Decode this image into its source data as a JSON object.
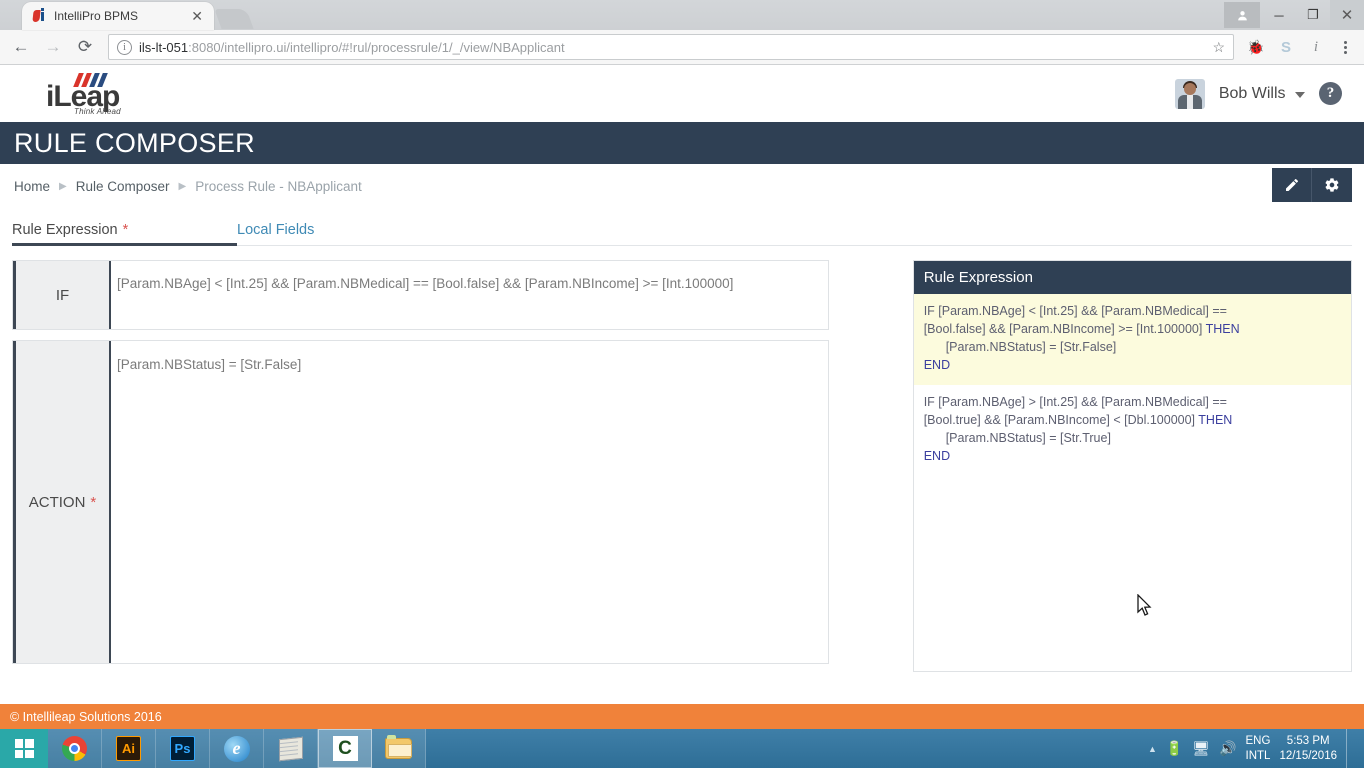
{
  "browser": {
    "tab": {
      "title": "IntelliPro BPMS",
      "favicon_icon": "ileap-favicon",
      "close_icon": "close-icon"
    },
    "new_tab_icon": "new-tab-icon",
    "window_controls": {
      "profile_icon": "person-icon",
      "minimize_label": "─",
      "maximize_label": "❐",
      "close_label": "✕"
    },
    "nav": {
      "back_label": "←",
      "forward_label": "→",
      "reload_label": "⟳"
    },
    "omnibox": {
      "info_icon": "site-info-icon",
      "info_label": "i",
      "host": "ils-lt-051",
      "path": ":8080/intellipro.ui/intellipro/#!rul/processrule/1/_/view/NBApplicant",
      "url_full": "ils-lt-051:8080/intellipro.ui/intellipro/#!rul/processrule/1/_/view/NBApplicant",
      "star_label": "☆"
    },
    "extensions": [
      {
        "name": "bug-icon",
        "label": "🐞"
      },
      {
        "name": "skype-icon",
        "label": "S"
      },
      {
        "name": "info-extension-icon",
        "label": "i"
      }
    ],
    "menu_icon": "three-dot-menu-icon"
  },
  "app": {
    "logo": {
      "word": "iLeap",
      "tagline": "Think Ahead"
    },
    "user": {
      "name": "Bob Wills",
      "avatar_icon": "avatar",
      "caret_icon": "chevron-down-icon"
    },
    "help_icon_label": "?",
    "page_title": "RULE COMPOSER",
    "breadcrumb": [
      {
        "label": "Home",
        "muted": false
      },
      {
        "label": "Rule Composer",
        "muted": false
      },
      {
        "label": "Process Rule - NBApplicant",
        "muted": true
      }
    ],
    "breadcrumb_separator": "▶",
    "actions": [
      {
        "name": "edit-button",
        "icon": "pencil-icon"
      },
      {
        "name": "settings-button",
        "icon": "gear-icon"
      }
    ],
    "tabs": [
      {
        "label": "Rule Expression",
        "required": "*",
        "active": true
      },
      {
        "label": "Local Fields",
        "required": "",
        "active": false
      }
    ],
    "rule_rows": [
      {
        "label": "IF",
        "required": "",
        "value": "[Param.NBAge] < [Int.25]  &&  [Param.NBMedical] == [Bool.false]   &&   [Param.NBIncome] >= [Int.100000]"
      },
      {
        "label": "ACTION",
        "required": "*",
        "value": "[Param.NBStatus] = [Str.False]"
      }
    ],
    "panel": {
      "title": "Rule Expression",
      "blocks": [
        {
          "highlighted": true,
          "line1_pre": "IF [Param.NBAge] < [Int.25] && [Param.NBMedical] ==",
          "line2_pre": "[Bool.false] && [Param.NBIncome] >= [Int.100000] ",
          "line2_kw": "THEN",
          "line3": "[Param.NBStatus] = [Str.False]",
          "line4_kw": "END"
        },
        {
          "highlighted": false,
          "line1_pre": "IF [Param.NBAge] > [Int.25] && [Param.NBMedical] ==",
          "line2_pre": "[Bool.true] && [Param.NBIncome] < [Dbl.100000] ",
          "line2_kw": "THEN",
          "line3": "[Param.NBStatus] = [Str.True]",
          "line4_kw": "END"
        }
      ]
    },
    "footer": "© Intellileap Solutions 2016"
  },
  "taskbar": {
    "start_icon": "windows-start-icon",
    "items": [
      {
        "name": "taskbar-chrome",
        "icon": "chrome-icon",
        "label": "",
        "active": false
      },
      {
        "name": "taskbar-illustrator",
        "icon": "illustrator-icon",
        "label": "Ai",
        "active": false
      },
      {
        "name": "taskbar-photoshop",
        "icon": "photoshop-icon",
        "label": "Ps",
        "active": false
      },
      {
        "name": "taskbar-internet-explorer",
        "icon": "internet-explorer-icon",
        "label": "e",
        "active": false
      },
      {
        "name": "taskbar-notepad",
        "icon": "notepad-icon",
        "label": "",
        "active": false
      },
      {
        "name": "taskbar-camtasia",
        "icon": "camtasia-icon",
        "label": "C",
        "active": true
      },
      {
        "name": "taskbar-file-explorer",
        "icon": "file-explorer-icon",
        "label": "",
        "active": false
      }
    ],
    "tray": {
      "arrow_icon": "show-hidden-icons-icon",
      "battery_icon": "battery-icon",
      "network_icon": "network-icon",
      "volume_icon": "volume-icon",
      "volume_label": "🔊",
      "language_line1": "ENG",
      "language_line2": "INTL",
      "time": "5:53 PM",
      "date": "12/15/2016"
    }
  }
}
